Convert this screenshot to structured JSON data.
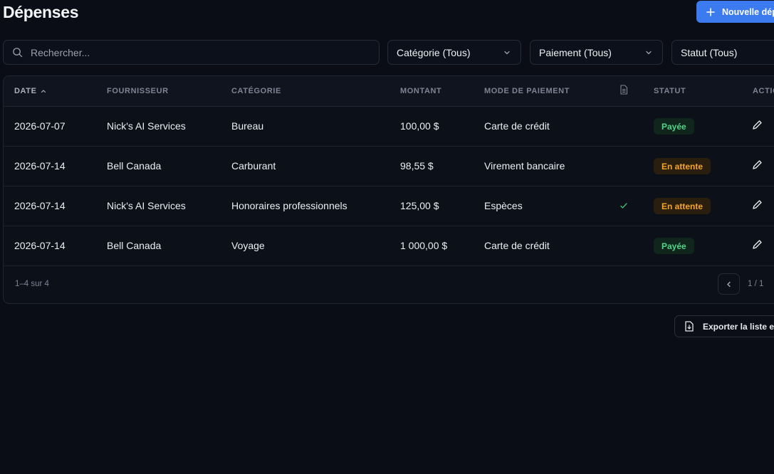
{
  "header": {
    "title": "Dépenses",
    "new_button_label": "Nouvelle dépense",
    "new_button_icon": "plus-icon"
  },
  "filters": {
    "search_placeholder": "Rechercher...",
    "search_value": "",
    "category": "Catégorie (Tous)",
    "payment": "Paiement (Tous)",
    "status": "Statut (Tous)"
  },
  "table": {
    "columns": {
      "date": "DATE",
      "vendor": "FOURNISSEUR",
      "category": "CATÉGORIE",
      "amount": "MONTANT",
      "payment": "MODE DE PAIEMENT",
      "receipt_icon": "document-icon",
      "status": "STATUT",
      "actions": "ACTIONS"
    },
    "sort": {
      "column": "date",
      "direction": "ascending"
    },
    "rows": [
      {
        "date": "2026-07-07",
        "vendor": "Nick's AI Services",
        "category": "Bureau",
        "amount": "100,00 $",
        "payment": "Carte de crédit",
        "receipt": false,
        "status": "Payée",
        "status_kind": "paid"
      },
      {
        "date": "2026-07-14",
        "vendor": "Bell Canada",
        "category": "Carburant",
        "amount": "98,55 $",
        "payment": "Virement bancaire",
        "receipt": false,
        "status": "En attente",
        "status_kind": "pending"
      },
      {
        "date": "2026-07-14",
        "vendor": "Nick's AI Services",
        "category": "Honoraires professionnels",
        "amount": "125,00 $",
        "payment": "Espèces",
        "receipt": true,
        "status": "En attente",
        "status_kind": "pending"
      },
      {
        "date": "2026-07-14",
        "vendor": "Bell Canada",
        "category": "Voyage",
        "amount": "1 000,00 $",
        "payment": "Carte de crédit",
        "receipt": false,
        "status": "Payée",
        "status_kind": "paid"
      }
    ]
  },
  "pagination": {
    "count_text": "1–4 sur 4",
    "page_text": "1 / 1"
  },
  "export": {
    "label": "Exporter la liste en CSV",
    "icon": "file-download-icon"
  },
  "colors": {
    "accent": "#3b7bef",
    "paid": "#4fd688",
    "pending": "#f5a524",
    "background": "#0a0d16"
  }
}
